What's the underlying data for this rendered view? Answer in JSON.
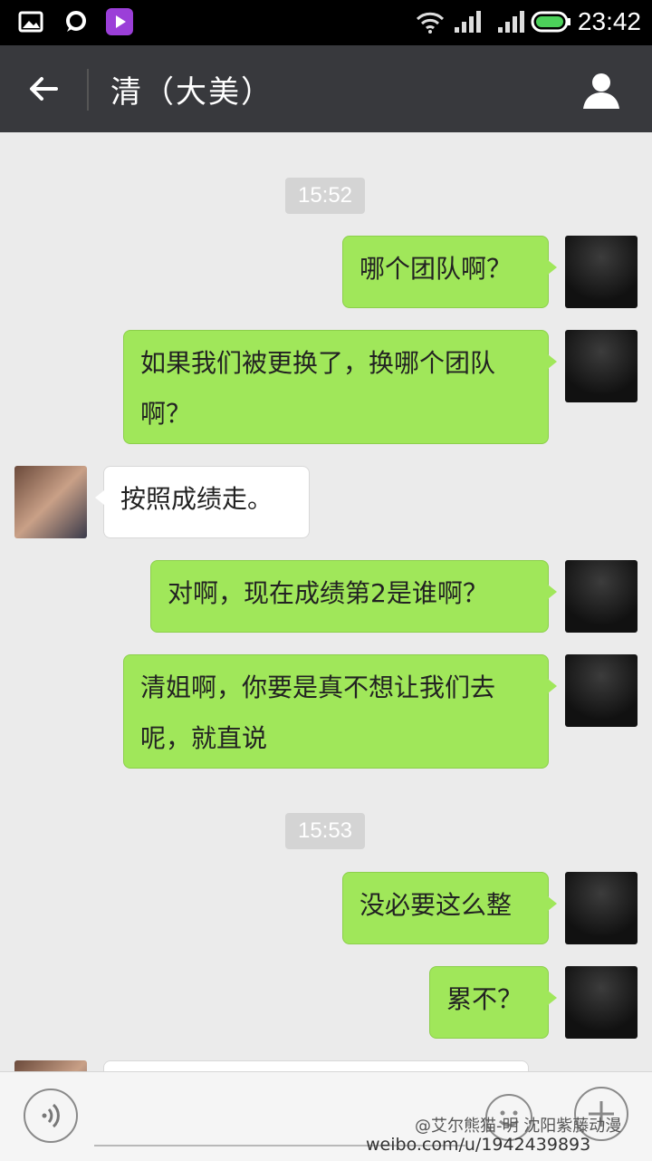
{
  "status_bar": {
    "time": "23:42"
  },
  "header": {
    "title": "清（大美）"
  },
  "messages": [
    {
      "type": "time",
      "text": "15:52"
    },
    {
      "type": "out",
      "text": "哪个团队啊？"
    },
    {
      "type": "out",
      "text": "如果我们被更换了，换哪个团队啊？"
    },
    {
      "type": "in",
      "text": "按照成绩走。"
    },
    {
      "type": "out",
      "text": "对啊，现在成绩第2是谁啊？"
    },
    {
      "type": "out",
      "text": "清姐啊，你要是真不想让我们去呢，就直说"
    },
    {
      "type": "time",
      "text": "15:53"
    },
    {
      "type": "out",
      "text": "没必要这么整"
    },
    {
      "type": "out",
      "text": "累不？"
    }
  ],
  "watermark": {
    "line1": "@艾尔熊猫-明 沈阳紫藤动漫",
    "line2": "weibo.com/u/1942439893"
  },
  "colors": {
    "outgoing_bubble": "#a0e75a",
    "incoming_bubble": "#ffffff",
    "header": "#38393d",
    "background": "#ebebeb"
  }
}
